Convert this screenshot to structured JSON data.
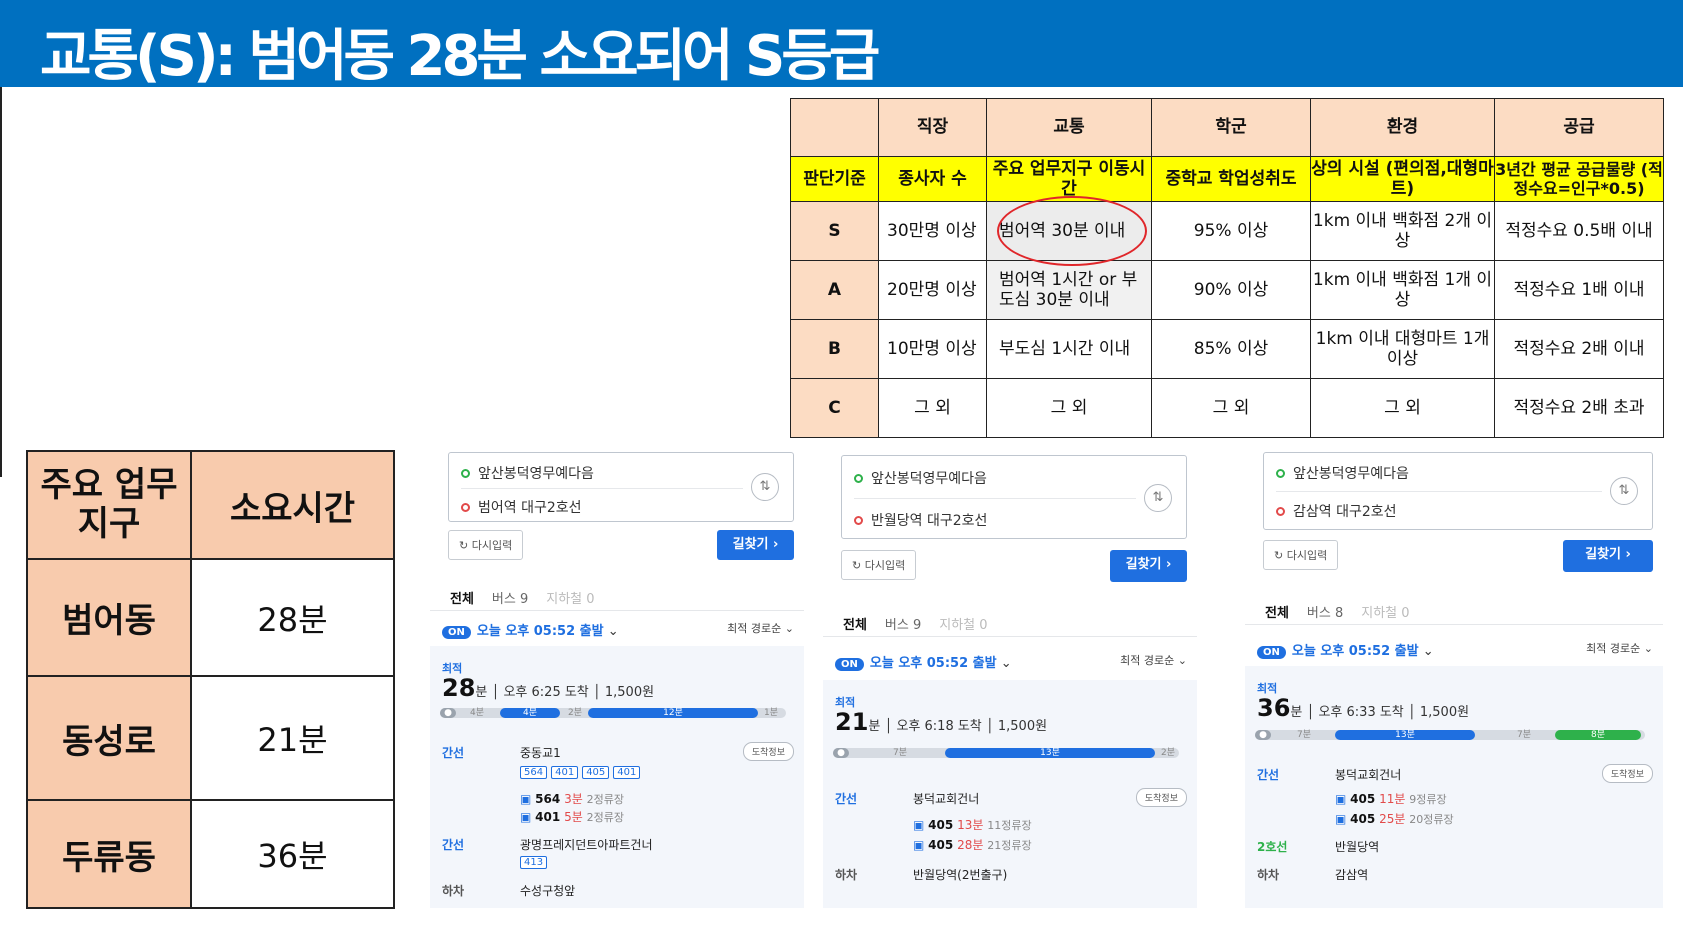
{
  "title": "교통(S): 범어동 28분 소요되어 S등급",
  "criteria_table": {
    "header_row": [
      "",
      "직장",
      "교통",
      "학군",
      "환경",
      "공급"
    ],
    "sub_row": [
      "판단기준",
      "종사자 수",
      "주요 업무지구 이동시간",
      "중학교 학업성취도",
      "상의 시설 (편의점,대형마트)",
      "3년간 평균 공급물량 (적정수요=인구*0.5)"
    ],
    "rows": [
      {
        "grade": "S",
        "cells": [
          "30만명 이상",
          "범어역 30분 이내",
          "95% 이상",
          "1km 이내 백화점 2개 이상",
          "적정수요 0.5배 이내"
        ]
      },
      {
        "grade": "A",
        "cells": [
          "20만명 이상",
          "범어역 1시간 or 부도심 30분 이내",
          "90% 이상",
          "1km 이내 백화점 1개 이상",
          "적정수요 1배 이내"
        ]
      },
      {
        "grade": "B",
        "cells": [
          "10만명 이상",
          "부도심 1시간 이내",
          "85% 이상",
          "1km 이내 대형마트 1개 이상",
          "적정수요 2배 이내"
        ]
      },
      {
        "grade": "C",
        "cells": [
          "그 외",
          "그 외",
          "그 외",
          "그 외",
          "적정수요 2배 초과"
        ]
      }
    ]
  },
  "summary_table": {
    "headers": [
      "주요 업무지구",
      "소요시간"
    ],
    "rows": [
      {
        "district": "범어동",
        "time": "28분"
      },
      {
        "district": "동성로",
        "time": "21분"
      },
      {
        "district": "두류동",
        "time": "36분"
      }
    ]
  },
  "route_screens": [
    {
      "from": "앞산봉덕영무예다음",
      "to": "범어역 대구2호선",
      "reset": "다시입력",
      "go": "길찾기",
      "tabs": [
        "전체",
        "버스 9",
        "지하철 0"
      ],
      "on": "ON",
      "depart": "오늘 오후 05:52 출발",
      "sort": "최적 경로순",
      "best": "최적",
      "minutes": "28",
      "min_unit": "분",
      "arrive": "오후 6:25 도착",
      "fare": "1,500원",
      "bar_labels": [
        "4분",
        "4분",
        "2분",
        "12분",
        "1분"
      ],
      "stop1_kind": "간선",
      "stop1_name": "중동교1",
      "stop1_btn": "도착정보",
      "bus_nums": [
        "564",
        "401",
        "405",
        "401"
      ],
      "arr1": {
        "num": "564",
        "time": "3분",
        "stops": "2정류장"
      },
      "arr2": {
        "num": "401",
        "time": "5분",
        "stops": "2정류장"
      },
      "stop2_kind": "간선",
      "stop2_name": "광명프레지던트아파트건너",
      "bus2": "413",
      "stop3_kind": "하차",
      "stop3_name": "수성구청앞"
    },
    {
      "from": "앞산봉덕영무예다음",
      "to": "반월당역 대구2호선",
      "reset": "다시입력",
      "go": "길찾기",
      "tabs": [
        "전체",
        "버스 9",
        "지하철 0"
      ],
      "on": "ON",
      "depart": "오늘 오후 05:52 출발",
      "sort": "최적 경로순",
      "best": "최적",
      "minutes": "21",
      "min_unit": "분",
      "arrive": "오후 6:18 도착",
      "fare": "1,500원",
      "bar_labels": [
        "7분",
        "13분",
        "2분"
      ],
      "stop1_kind": "간선",
      "stop1_name": "봉덕교회건너",
      "stop1_btn": "도착정보",
      "arr1": {
        "num": "405",
        "time": "13분",
        "stops": "11정류장"
      },
      "arr2": {
        "num": "405",
        "time": "28분",
        "stops": "21정류장"
      },
      "stop3_kind": "하차",
      "stop3_name": "반월당역(2번출구)"
    },
    {
      "from": "앞산봉덕영무예다음",
      "to": "감삼역 대구2호선",
      "reset": "다시입력",
      "go": "길찾기",
      "tabs": [
        "전체",
        "버스 8",
        "지하철 0"
      ],
      "on": "ON",
      "depart": "오늘 오후 05:52 출발",
      "sort": "최적 경로순",
      "best": "최적",
      "minutes": "36",
      "min_unit": "분",
      "arrive": "오후 6:33 도착",
      "fare": "1,500원",
      "bar_labels": [
        "7분",
        "13분",
        "7분",
        "8분"
      ],
      "stop1_kind": "간선",
      "stop1_name": "봉덕교회건너",
      "stop1_btn": "도착정보",
      "arr1": {
        "num": "405",
        "time": "11분",
        "stops": "9정류장"
      },
      "arr2": {
        "num": "405",
        "time": "25분",
        "stops": "20정류장"
      },
      "stop2_kind": "2호선",
      "stop2_name": "반월당역",
      "stop3_kind": "하차",
      "stop3_name": "감삼역"
    }
  ],
  "colors": {
    "banner": "#0070c0",
    "header_peach": "#fcdcc3",
    "criteria_yellow": "#ffff00",
    "summary_peach": "#f8cbad",
    "highlight_circle": "#e0262a",
    "accent_blue": "#1f6fe0",
    "subway_green": "#2eb14b"
  }
}
